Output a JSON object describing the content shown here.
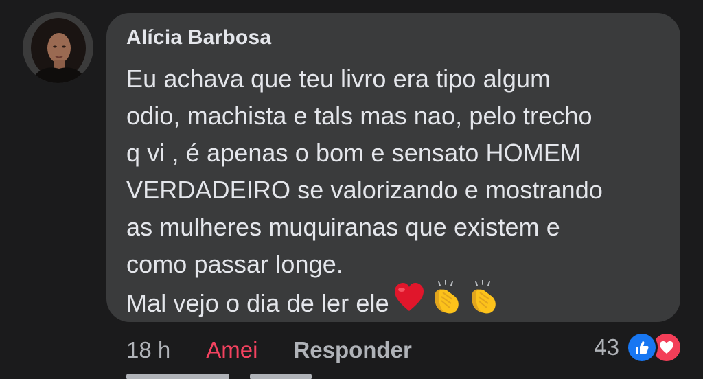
{
  "comment": {
    "author": "Alícia Barbosa",
    "lines": [
      "Eu achava que teu livro era tipo algum",
      "odio, machista e tals mas nao, pelo trecho",
      "q vi , é apenas o bom e sensato HOMEM",
      "VERDADEIRO se valorizando e mostrando",
      "as mulheres muquiranas que existem e",
      "como passar longe.",
      "Mal vejo o dia de ler ele"
    ],
    "emojis": [
      "red-heart",
      "clapping-hands",
      "clapping-hands"
    ]
  },
  "actions": {
    "time": "18 h",
    "like_label": "Amei",
    "reply_label": "Responder"
  },
  "reactions": {
    "count": "43",
    "types": [
      "like-icon",
      "love-icon"
    ]
  },
  "colors": {
    "background": "#1b1b1c",
    "bubble": "#3a3b3c",
    "text": "#e4e6eb",
    "muted": "#b0b3b8",
    "love": "#f3425f",
    "like_blue": "#1877f2"
  }
}
